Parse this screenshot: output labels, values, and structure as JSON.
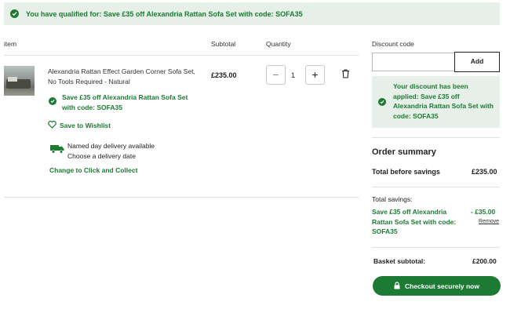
{
  "banner": {
    "text": "You have qualified for: Save £35 off Alexandria Rattan Sofa Set with code: SOFA35",
    "icon": "check-circle-icon"
  },
  "table": {
    "headers": {
      "item": "item",
      "subtotal": "Subtotal",
      "quantity": "Quantity"
    }
  },
  "product": {
    "name": "Alexandria Rattan Effect Garden Corner Sofa Set, No Tools Required - Natural",
    "offer": "Save £35 off Alexandria Rattan Sofa Set with code: SOFA35",
    "wishlist_label": "Save to Wishlist",
    "delivery_line1": "Named day delivery available",
    "delivery_line2": "Choose a delivery date",
    "collect_link": "Change to Click and Collect",
    "subtotal": "£235.00",
    "quantity": "1",
    "minus_symbol": "−",
    "plus_symbol": "+"
  },
  "discount": {
    "label": "Discount code",
    "input_value": "",
    "input_placeholder": "",
    "add_button": "Add",
    "applied_message": "Your discount has been applied: Save £35 off Alexandria Rattan Sofa Set with code: SOFA35"
  },
  "summary": {
    "title": "Order summary",
    "total_before_savings_label": "Total before savings",
    "total_before_savings_value": "£235.00",
    "total_savings_label": "Total savings:",
    "saving_description": "Save £35 off Alexandria Rattan Sofa Set with code: SOFA35",
    "saving_amount": "- £35.00",
    "remove_link": "Remove",
    "basket_subtotal_label": "Basket subtotal:",
    "basket_subtotal_value": "£200.00",
    "checkout_button": "Checkout securely now"
  },
  "colors": {
    "brand_green": "#1c7a33",
    "banner_bg": "#e6f0e8"
  }
}
